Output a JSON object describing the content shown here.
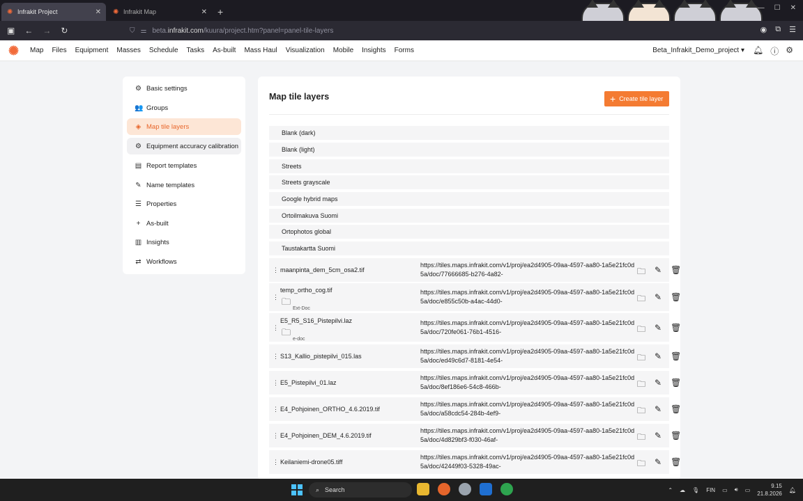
{
  "browser": {
    "tabs": [
      {
        "label": "Infrakit Project",
        "close": "✕"
      },
      {
        "label": "Infrakit Map",
        "close": "✕"
      }
    ],
    "new_tab": "+",
    "url_prefix": "beta.",
    "url_host": "infrakit.com",
    "url_path": "/kuura/project.htm?panel=panel-tile-layers"
  },
  "app": {
    "menu": [
      "Map",
      "Files",
      "Equipment",
      "Masses",
      "Schedule",
      "Tasks",
      "As-built",
      "Mass Haul",
      "Visualization",
      "Mobile",
      "Insights",
      "Forms"
    ],
    "project": "Beta_Infrakit_Demo_project ▾"
  },
  "sidebar": {
    "items": [
      {
        "label": "Basic settings",
        "icon": "⚙"
      },
      {
        "label": "Groups",
        "icon": "👥"
      },
      {
        "label": "Map tile layers",
        "icon": "◈"
      },
      {
        "label": "Equipment accuracy calibration",
        "icon": "⚙"
      },
      {
        "label": "Report templates",
        "icon": "▤"
      },
      {
        "label": "Name templates",
        "icon": "✎"
      },
      {
        "label": "Properties",
        "icon": "☰"
      },
      {
        "label": "As-built",
        "icon": "+"
      },
      {
        "label": "Insights",
        "icon": "▥"
      },
      {
        "label": "Workflows",
        "icon": "⇄"
      }
    ]
  },
  "main": {
    "title": "Map tile layers",
    "create_button": "Create tile layer",
    "basic_layers": [
      "Blank (dark)",
      "Blank (light)",
      "Streets",
      "Streets grayscale",
      "Google hybrid maps",
      "Ortoilmakuva Suomi",
      "Ortophotos global",
      "Taustakartta Suomi"
    ],
    "custom_layers": [
      {
        "name": "maanpinta_dem_5cm_osa2.tif",
        "sub": "",
        "url": "https://tiles.maps.infrakit.com/v1/proj/ea2d4905-09aa-4597-aa80-1a5e21fc0d5a/doc/77666685-b276-4a82-"
      },
      {
        "name": "temp_ortho_cog.tif",
        "sub": "Ext-Doc",
        "url": "https://tiles.maps.infrakit.com/v1/proj/ea2d4905-09aa-4597-aa80-1a5e21fc0d5a/doc/e855c50b-a4ac-44d0-"
      },
      {
        "name": "E5_R5_S16_Pistepilvi.laz",
        "sub": "e-doc",
        "url": "https://tiles.maps.infrakit.com/v1/proj/ea2d4905-09aa-4597-aa80-1a5e21fc0d5a/doc/720fe061-76b1-4516-"
      },
      {
        "name": "S13_Kallio_pistepilvi_015.las",
        "sub": "",
        "url": "https://tiles.maps.infrakit.com/v1/proj/ea2d4905-09aa-4597-aa80-1a5e21fc0d5a/doc/ed49c6d7-8181-4e54-"
      },
      {
        "name": "E5_Pistepilvi_01.laz",
        "sub": "",
        "url": "https://tiles.maps.infrakit.com/v1/proj/ea2d4905-09aa-4597-aa80-1a5e21fc0d5a/doc/8ef186e6-54c8-466b-"
      },
      {
        "name": "E4_Pohjoinen_ORTHO_4.6.2019.tif",
        "sub": "",
        "url": "https://tiles.maps.infrakit.com/v1/proj/ea2d4905-09aa-4597-aa80-1a5e21fc0d5a/doc/a58cdc54-284b-4ef9-"
      },
      {
        "name": "E4_Pohjoinen_DEM_4.6.2019.tif",
        "sub": "",
        "url": "https://tiles.maps.infrakit.com/v1/proj/ea2d4905-09aa-4597-aa80-1a5e21fc0d5a/doc/4d829bf3-f030-46af-"
      },
      {
        "name": "Keilaniemi-drone05.tiff",
        "sub": "",
        "url": "https://tiles.maps.infrakit.com/v1/proj/ea2d4905-09aa-4597-aa80-1a5e21fc0d5a/doc/42449f03-5328-49ac-"
      }
    ]
  },
  "taskbar": {
    "search": "Search",
    "lang": "FIN",
    "time": "9.15",
    "date": "21.8.2026"
  },
  "colors": {
    "accent": "#f47b32",
    "active_bg": "#fde6d6"
  }
}
